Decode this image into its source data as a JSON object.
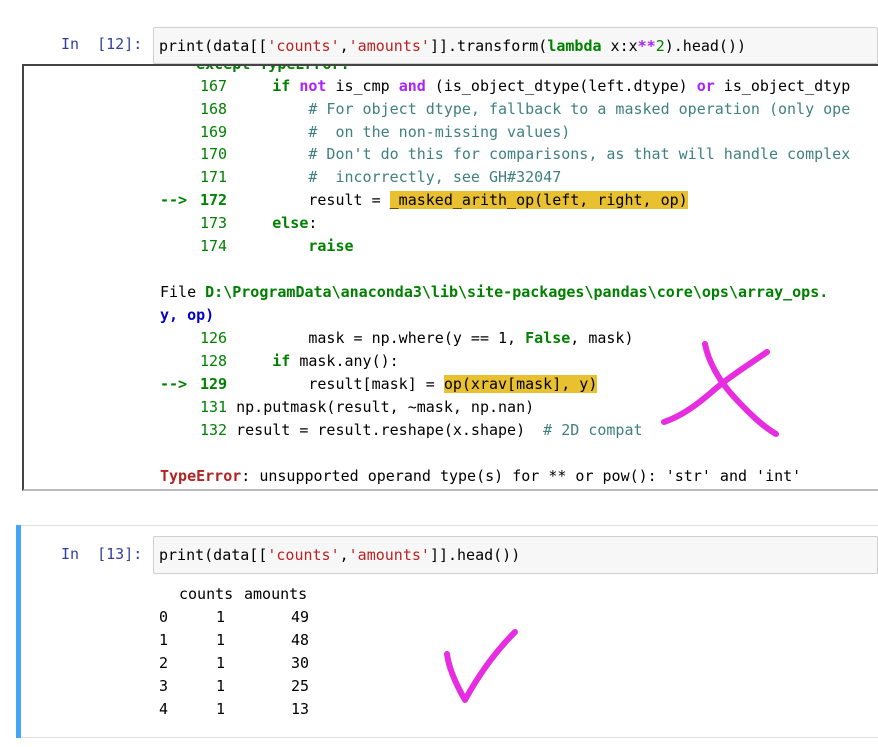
{
  "cell12": {
    "prompt": "In  [12]:",
    "code": {
      "p1": "print(data[[",
      "s1": "'counts'",
      "p2": ",",
      "s2": "'amounts'",
      "p3": "]].transform(",
      "kw": "lambda",
      "p4": " x:x",
      "op": "**",
      "num": "2",
      "p5": ").head())"
    },
    "traceback": {
      "partial_top": "    except TypeError:",
      "lines": [
        {
          "arrow": "",
          "num": "167",
          "indent": "    ",
          "segments": [
            {
              "c": "kw",
              "t": "if"
            },
            {
              "c": "",
              "t": " "
            },
            {
              "c": "op",
              "t": "not"
            },
            {
              "c": "",
              "t": " is_cmp "
            },
            {
              "c": "op",
              "t": "and"
            },
            {
              "c": "",
              "t": " (is_object_dtype(left.dtype) "
            },
            {
              "c": "op",
              "t": "or"
            },
            {
              "c": "",
              "t": " is_object_dtyp"
            }
          ]
        },
        {
          "arrow": "",
          "num": "168",
          "indent": "        ",
          "segments": [
            {
              "c": "cmt",
              "t": "# For object dtype, fallback to a masked operation (only ope"
            }
          ]
        },
        {
          "arrow": "",
          "num": "169",
          "indent": "        ",
          "segments": [
            {
              "c": "cmt",
              "t": "#  on the non-missing values)"
            }
          ]
        },
        {
          "arrow": "",
          "num": "170",
          "indent": "        ",
          "segments": [
            {
              "c": "cmt",
              "t": "# Don't do this for comparisons, as that will handle complex"
            }
          ]
        },
        {
          "arrow": "",
          "num": "171",
          "indent": "        ",
          "segments": [
            {
              "c": "cmt",
              "t": "#  incorrectly, see GH#32047"
            }
          ]
        },
        {
          "arrow": "--> ",
          "num": "172",
          "indent": "        ",
          "segments": [
            {
              "c": "",
              "t": "result = "
            },
            {
              "c": "hl",
              "t": "_masked_arith_op(left, right, op)"
            }
          ]
        },
        {
          "arrow": "",
          "num": "173",
          "indent": "    ",
          "segments": [
            {
              "c": "kw",
              "t": "else"
            },
            {
              "c": "",
              "t": ":"
            }
          ]
        },
        {
          "arrow": "",
          "num": "174",
          "indent": "        ",
          "segments": [
            {
              "c": "kw",
              "t": "raise"
            }
          ]
        }
      ],
      "file_prefix": "File ",
      "file_path": "D:\\ProgramData\\anaconda3\\lib\\site-packages\\pandas\\core\\ops\\array_ops.",
      "file_cont": "y, op)",
      "lines2": [
        {
          "arrow": "",
          "num": "126",
          "indent": "        ",
          "segments": [
            {
              "c": "",
              "t": "mask = np.where(y == 1, "
            },
            {
              "c": "kw",
              "t": "False"
            },
            {
              "c": "",
              "t": ", mask)"
            }
          ]
        },
        {
          "arrow": "",
          "num": "128",
          "indent": "    ",
          "segments": [
            {
              "c": "kw",
              "t": "if"
            },
            {
              "c": "",
              "t": " mask.any():"
            }
          ]
        },
        {
          "arrow": "--> ",
          "num": "129",
          "indent": "        ",
          "segments": [
            {
              "c": "",
              "t": "result[mask] = "
            },
            {
              "c": "hl",
              "t": "op(xrav[mask], y)"
            }
          ]
        },
        {
          "arrow": "",
          "num": "131",
          "indent": "",
          "segments": [
            {
              "c": "",
              "t": "np.putmask(result, ~mask, np.nan)"
            }
          ]
        },
        {
          "arrow": "",
          "num": "132",
          "indent": "",
          "segments": [
            {
              "c": "",
              "t": "result = result.reshape(x.shape)  "
            },
            {
              "c": "cmt",
              "t": "# 2D compat"
            }
          ]
        }
      ],
      "error_type": "TypeError",
      "error_msg": ": unsupported operand type(s) for ** or pow(): 'str' and 'int'"
    }
  },
  "cell13": {
    "prompt": "In  [13]:",
    "code": {
      "p1": "print(data[[",
      "s1": "'counts'",
      "p2": ",",
      "s2": "'amounts'",
      "p3": "]].head())"
    },
    "df": {
      "columns": [
        "counts",
        "amounts"
      ],
      "rows": [
        {
          "idx": "0",
          "counts": "1",
          "amounts": "49"
        },
        {
          "idx": "1",
          "counts": "1",
          "amounts": "48"
        },
        {
          "idx": "2",
          "counts": "1",
          "amounts": "30"
        },
        {
          "idx": "3",
          "counts": "1",
          "amounts": "25"
        },
        {
          "idx": "4",
          "counts": "1",
          "amounts": "13"
        }
      ]
    }
  },
  "annotations": {
    "cross_color": "#e62ee0",
    "check_color": "#e62ee0"
  },
  "colors": {
    "selected_cell_bar": "#42a5f5",
    "prompt": "#303f9f",
    "keyword": "#008000",
    "string": "#ba2121",
    "highlight": "#e8c030"
  }
}
